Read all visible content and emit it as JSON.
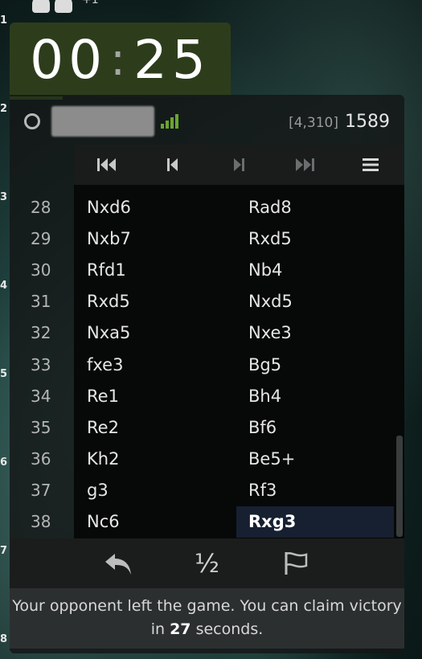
{
  "board_ranks": [
    "1",
    "2",
    "3",
    "4",
    "5",
    "6",
    "7",
    "8"
  ],
  "captured": {
    "plus_text": "+1"
  },
  "clock": {
    "minutes": "00",
    "seconds": "25"
  },
  "player": {
    "meta": "[4,310]",
    "rating": "1589"
  },
  "controls": {
    "first": "first-move-icon",
    "prev": "previous-move-icon",
    "next": "next-move-icon",
    "last": "last-move-icon",
    "menu": "menu-icon"
  },
  "moves": [
    {
      "num": "28",
      "white": "Nxd6",
      "black": "Rad8"
    },
    {
      "num": "29",
      "white": "Nxb7",
      "black": "Rxd5"
    },
    {
      "num": "30",
      "white": "Rfd1",
      "black": "Nb4"
    },
    {
      "num": "31",
      "white": "Rxd5",
      "black": "Nxd5"
    },
    {
      "num": "32",
      "white": "Nxa5",
      "black": "Nxe3"
    },
    {
      "num": "33",
      "white": "fxe3",
      "black": "Bg5"
    },
    {
      "num": "34",
      "white": "Re1",
      "black": "Bh4"
    },
    {
      "num": "35",
      "white": "Re2",
      "black": "Bf6"
    },
    {
      "num": "36",
      "white": "Kh2",
      "black": "Be5+"
    },
    {
      "num": "37",
      "white": "g3",
      "black": "Rf3"
    },
    {
      "num": "38",
      "white": "Nc6",
      "black": "Rxg3"
    }
  ],
  "actions": {
    "takeback": "takeback-icon",
    "draw_label": "½",
    "resign": "resign-flag-icon"
  },
  "notice": {
    "before": "Your opponent left the game. You can claim victory in ",
    "seconds": "27",
    "after": " seconds."
  },
  "colors": {
    "clock_bg": "#2d3d1c",
    "clock_bar": "#7bbf38",
    "signal": "#6aa531",
    "current_move_bg": "#162030"
  }
}
